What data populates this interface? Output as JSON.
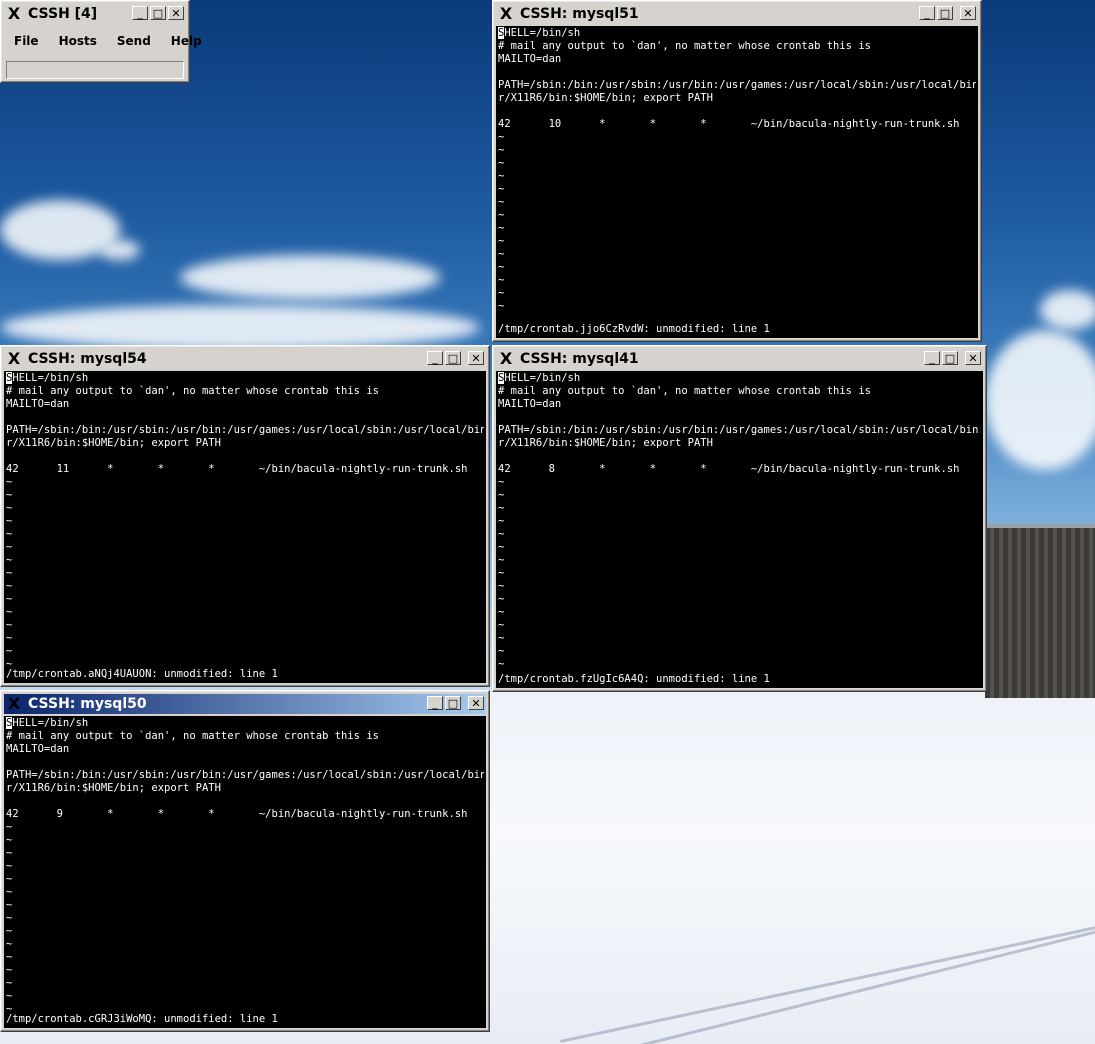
{
  "controller": {
    "title": "CSSH [4]",
    "menus": [
      "File",
      "Hosts",
      "Send",
      "Help"
    ],
    "input_value": ""
  },
  "window_buttons": {
    "minimize": "_",
    "maximize": "□",
    "close": "✕",
    "x_icon": "X"
  },
  "windows": [
    {
      "title": "CSSH: mysql51",
      "cursor_char": "S",
      "lines": [
        "HELL=/bin/sh",
        "# mail any output to `dan', no matter whose crontab this is",
        "MAILTO=dan",
        "",
        "PATH=/sbin:/bin:/usr/sbin:/usr/bin:/usr/games:/usr/local/sbin:/usr/local/bin:/us",
        "r/X11R6/bin:$HOME/bin; export PATH",
        "",
        "42      10      *       *       *       ~/bin/bacula-nightly-run-trunk.sh",
        "~",
        "~",
        "~",
        "~",
        "~",
        "~",
        "~",
        "~",
        "~",
        "~",
        "~",
        "~",
        "~",
        "~"
      ],
      "status": "/tmp/crontab.jjo6CzRvdW: unmodified: line 1"
    },
    {
      "title": "CSSH: mysql54",
      "cursor_char": "S",
      "lines": [
        "HELL=/bin/sh",
        "# mail any output to `dan', no matter whose crontab this is",
        "MAILTO=dan",
        "",
        "PATH=/sbin:/bin:/usr/sbin:/usr/bin:/usr/games:/usr/local/sbin:/usr/local/bin:/us",
        "r/X11R6/bin:$HOME/bin; export PATH",
        "",
        "42      11      *       *       *       ~/bin/bacula-nightly-run-trunk.sh",
        "~",
        "~",
        "~",
        "~",
        "~",
        "~",
        "~",
        "~",
        "~",
        "~",
        "~",
        "~",
        "~",
        "~",
        "~"
      ],
      "status": "/tmp/crontab.aNQj4UAUON: unmodified: line 1"
    },
    {
      "title": "CSSH: mysql41",
      "cursor_char": "S",
      "lines": [
        "HELL=/bin/sh",
        "# mail any output to `dan', no matter whose crontab this is",
        "MAILTO=dan",
        "",
        "PATH=/sbin:/bin:/usr/sbin:/usr/bin:/usr/games:/usr/local/sbin:/usr/local/bin:/us",
        "r/X11R6/bin:$HOME/bin; export PATH",
        "",
        "42      8       *       *       *       ~/bin/bacula-nightly-run-trunk.sh",
        "~",
        "~",
        "~",
        "~",
        "~",
        "~",
        "~",
        "~",
        "~",
        "~",
        "~",
        "~",
        "~",
        "~",
        "~"
      ],
      "status": "/tmp/crontab.fzUgIc6A4Q: unmodified: line 1"
    },
    {
      "title": "CSSH: mysql50",
      "cursor_char": "S",
      "lines": [
        "HELL=/bin/sh",
        "# mail any output to `dan', no matter whose crontab this is",
        "MAILTO=dan",
        "",
        "PATH=/sbin:/bin:/usr/sbin:/usr/bin:/usr/games:/usr/local/sbin:/usr/local/bin:/us",
        "r/X11R6/bin:$HOME/bin; export PATH",
        "",
        "42      9       *       *       *       ~/bin/bacula-nightly-run-trunk.sh",
        "~",
        "~",
        "~",
        "~",
        "~",
        "~",
        "~",
        "~",
        "~",
        "~",
        "~",
        "~",
        "~",
        "~",
        "~"
      ],
      "status": "/tmp/crontab.cGRJ3iWoMQ: unmodified: line 1"
    }
  ]
}
